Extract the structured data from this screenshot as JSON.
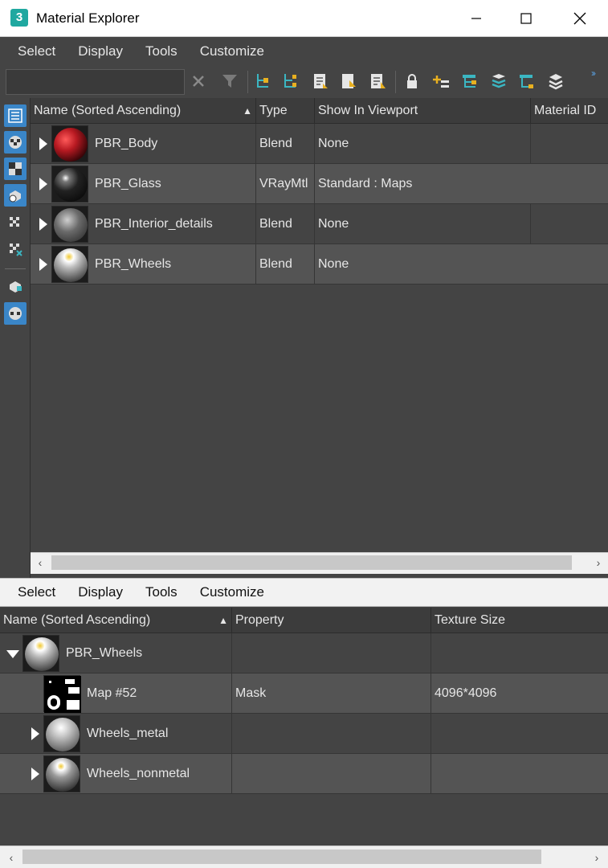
{
  "window": {
    "title": "Material Explorer",
    "app_icon_label": "3",
    "controls": [
      "minimize",
      "maximize",
      "close"
    ]
  },
  "top_menu": [
    "Select",
    "Display",
    "Tools",
    "Customize"
  ],
  "search": {
    "value": "",
    "placeholder": ""
  },
  "toolbar_icons": [
    "clear-search-icon",
    "filter-icon",
    "select-children-icon",
    "select-instances-icon",
    "find-material-icon",
    "select-by-material-icon",
    "edit-material-icon",
    "lock-icon",
    "add-material-icon",
    "hierarchy-icon",
    "layers-down-icon",
    "tree-icon",
    "layers-icon"
  ],
  "left_strip_icons": [
    "list-view-icon",
    "checker-material-icon",
    "checker-map-icon",
    "object-material-icon",
    "checker-small-icon",
    "checker-x-icon",
    "object-assign-icon",
    "sphere-checker-icon"
  ],
  "top_grid": {
    "columns": [
      {
        "label": "Name (Sorted Ascending)",
        "sorted": true
      },
      {
        "label": "Type"
      },
      {
        "label": "Show In Viewport"
      },
      {
        "label": "Material ID"
      }
    ],
    "rows": [
      {
        "name": "PBR_Body",
        "type": "Blend",
        "viewport": "None",
        "material_id": "",
        "thumb_color": "#b81a22"
      },
      {
        "name": "PBR_Glass",
        "type": "VRayMtl",
        "viewport": "Standard : Maps",
        "material_id": "",
        "thumb_color": "#222222"
      },
      {
        "name": "PBR_Interior_details",
        "type": "Blend",
        "viewport": "None",
        "material_id": "",
        "thumb_color": "#6a6a6a"
      },
      {
        "name": "PBR_Wheels",
        "type": "Blend",
        "viewport": "None",
        "material_id": "",
        "thumb_color": "#9a9a9a"
      }
    ]
  },
  "bottom_menu": [
    "Select",
    "Display",
    "Tools",
    "Customize"
  ],
  "bottom_grid": {
    "columns": [
      {
        "label": "Name (Sorted Ascending)",
        "sorted": true
      },
      {
        "label": "Property"
      },
      {
        "label": "Texture Size"
      }
    ],
    "rows": [
      {
        "name": "PBR_Wheels",
        "property": "",
        "texture_size": "",
        "expanded": true
      },
      {
        "name": "Map #52",
        "property": "Mask",
        "texture_size": "4096*4096"
      },
      {
        "name": "Wheels_metal",
        "property": "",
        "texture_size": ""
      },
      {
        "name": "Wheels_nonmetal",
        "property": "",
        "texture_size": ""
      }
    ]
  },
  "colors": {
    "panel_bg": "#444444",
    "alt_row": "#545454",
    "header_bg": "#3c3c3c",
    "accent": "#3a86c8",
    "toolbar_teal": "#3bb6c2",
    "toolbar_yellow": "#e8b020"
  }
}
